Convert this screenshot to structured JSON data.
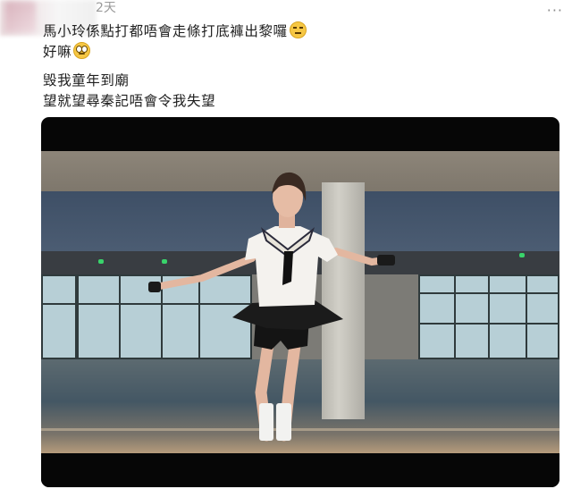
{
  "post": {
    "timestamp": "2天",
    "more_label": "···",
    "lines": [
      "馬小玲係點打都唔會走條打底褲出黎囉",
      "好嘛",
      "毁我童年到廟",
      "望就望尋秦記唔會令我失望"
    ],
    "emojis": [
      "unamused-face-icon",
      "eye-roll-face-icon"
    ]
  },
  "video": {
    "description_icon": "video-still-image"
  },
  "colors": {
    "text": "#1f1f1f",
    "timestamp": "#9a9a9a",
    "video_bg": "#060606"
  }
}
